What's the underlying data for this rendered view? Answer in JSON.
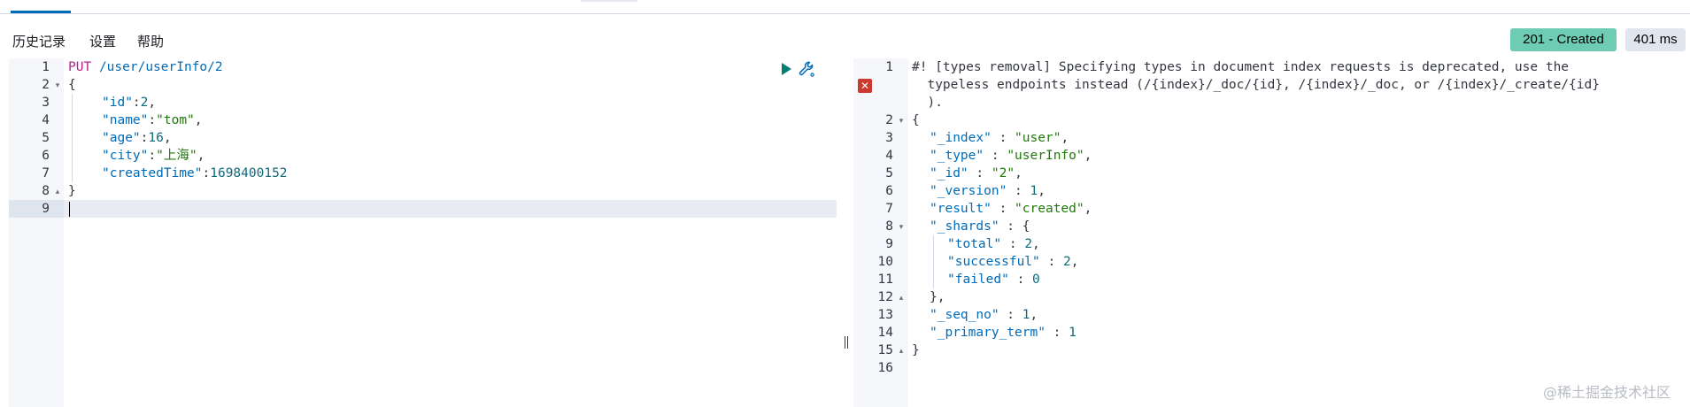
{
  "toolbar": {
    "history": "历史记录",
    "settings": "设置",
    "help": "帮助"
  },
  "response_status": {
    "status": "201 - Created",
    "time": "401 ms"
  },
  "request_editor": {
    "line_numbers": [
      "1",
      "2",
      "3",
      "4",
      "5",
      "6",
      "7",
      "8",
      "9"
    ],
    "method": "PUT",
    "path": "/user/userInfo/2",
    "open_brace": "{",
    "close_brace": "}",
    "fields": [
      {
        "key": "\"id\"",
        "sep": ":",
        "value": "2",
        "tail": ","
      },
      {
        "key": "\"name\"",
        "sep": ":",
        "value": "\"tom\"",
        "tail": ","
      },
      {
        "key": "\"age\"",
        "sep": ":",
        "value": "16",
        "tail": ","
      },
      {
        "key": "\"city\"",
        "sep": ":",
        "value": "\"上海\"",
        "tail": ","
      },
      {
        "key": "\"createdTime\"",
        "sep": ":",
        "value": "1698400152",
        "tail": ""
      }
    ]
  },
  "response_editor": {
    "line_numbers": [
      "1",
      "2",
      "3",
      "4",
      "5",
      "6",
      "7",
      "8",
      "9",
      "10",
      "11",
      "12",
      "13",
      "14",
      "15",
      "16"
    ],
    "warning_lines": [
      "#! [types removal] Specifying types in document index requests is deprecated, use the",
      "  typeless endpoints instead (/{index}/_doc/{id}, /{index}/_doc, or /{index}/_create/{id}",
      "  )."
    ],
    "open_brace": "{",
    "close_brace": "}",
    "fields": [
      {
        "key": "\"_index\"",
        "sep": " : ",
        "value": "\"user\"",
        "tail": ","
      },
      {
        "key": "\"_type\"",
        "sep": " : ",
        "value": "\"userInfo\"",
        "tail": ","
      },
      {
        "key": "\"_id\"",
        "sep": " : ",
        "value": "\"2\"",
        "tail": ","
      },
      {
        "key": "\"_version\"",
        "sep": " : ",
        "value": "1",
        "tail": ","
      },
      {
        "key": "\"result\"",
        "sep": " : ",
        "value": "\"created\"",
        "tail": ","
      }
    ],
    "shards_key": "\"_shards\"",
    "shards_open": " : {",
    "shards_fields": [
      {
        "key": "\"total\"",
        "sep": " : ",
        "value": "2",
        "tail": ","
      },
      {
        "key": "\"successful\"",
        "sep": " : ",
        "value": "2",
        "tail": ","
      },
      {
        "key": "\"failed\"",
        "sep": " : ",
        "value": "0",
        "tail": ""
      }
    ],
    "shards_close": "},",
    "tail_fields": [
      {
        "key": "\"_seq_no\"",
        "sep": " : ",
        "value": "1",
        "tail": ","
      },
      {
        "key": "\"_primary_term\"",
        "sep": " : ",
        "value": "1",
        "tail": ""
      }
    ]
  },
  "watermark": "@稀土掘金技术社区",
  "icons": {
    "run": "play-icon",
    "settings": "wrench-icon",
    "error": "error-x-icon",
    "splitter": "resize-grip-icon"
  },
  "colors": {
    "status_badge": "#6dccb1",
    "time_badge": "#e0e5ee",
    "method": "#b1248e",
    "key": "#006bb8",
    "string": "#1f7a0a",
    "run_icon": "#017d73",
    "error_icon": "#cc3a2f"
  }
}
